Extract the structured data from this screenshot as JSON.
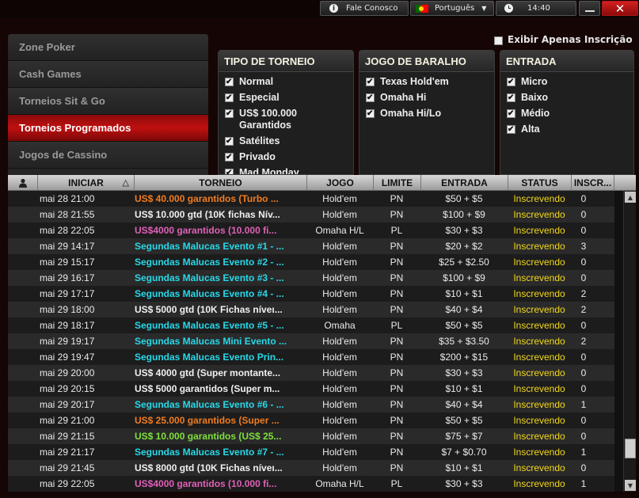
{
  "topbar": {
    "contact_label": "Fale Conosco",
    "language_label": "Português",
    "clock_label": "14:40",
    "close_label": "✕"
  },
  "menu": [
    {
      "label": "Zone Poker",
      "active": false
    },
    {
      "label": "Cash Games",
      "active": false
    },
    {
      "label": "Torneios Sit & Go",
      "active": false
    },
    {
      "label": "Torneios Programados",
      "active": true
    },
    {
      "label": "Jogos de Cassino",
      "active": false
    }
  ],
  "filters": {
    "exibir_label": "Exibir Apenas Inscrição",
    "tipo": {
      "title": "TIPO DE TORNEIO",
      "options": [
        "Normal",
        "Especial",
        "US$ 100.000 Garantidos",
        "Satélites",
        "Privado",
        "Mad Monday"
      ]
    },
    "jogo": {
      "title": "JOGO DE BARALHO",
      "options": [
        "Texas Hold'em",
        "Omaha Hi",
        "Omaha Hi/Lo"
      ]
    },
    "entrada": {
      "title": "ENTRADA",
      "options": [
        "Micro",
        "Baixo",
        "Médio",
        "Alta"
      ]
    }
  },
  "table": {
    "headers": [
      "INICIAR",
      "TORNEIO",
      "JOGO",
      "LIMITE",
      "ENTRADA",
      "STATUS",
      "INSCR..."
    ],
    "sort_indicator": "△",
    "rows": [
      {
        "date": "mai 28 21:00",
        "name": "US$ 40.000 garantidos (Turbo ...",
        "color": "#f07c20",
        "game": "Hold'em",
        "limit": "PN",
        "buyin": "$50 + $5",
        "status": "Inscrevendo",
        "reg": "0"
      },
      {
        "date": "mai 28 21:55",
        "name": "US$ 10.000 gtd (10K fichas Nív...",
        "color": "#f0f0f0",
        "game": "Hold'em",
        "limit": "PN",
        "buyin": "$100 + $9",
        "status": "Inscrevendo",
        "reg": "0"
      },
      {
        "date": "mai 28 22:05",
        "name": "US$4000 garantidos (10.000 fi...",
        "color": "#e060b8",
        "game": "Omaha H/L",
        "limit": "PL",
        "buyin": "$30 + $3",
        "status": "Inscrevendo",
        "reg": "0"
      },
      {
        "date": "mai 29 14:17",
        "name": "Segundas Malucas Evento #1 - ...",
        "color": "#28d8e8",
        "game": "Hold'em",
        "limit": "PN",
        "buyin": "$20 + $2",
        "status": "Inscrevendo",
        "reg": "3"
      },
      {
        "date": "mai 29 15:17",
        "name": "Segundas Malucas Evento #2 - ...",
        "color": "#28d8e8",
        "game": "Hold'em",
        "limit": "PN",
        "buyin": "$25 + $2.50",
        "status": "Inscrevendo",
        "reg": "0"
      },
      {
        "date": "mai 29 16:17",
        "name": "Segundas Malucas Evento #3 - ...",
        "color": "#28d8e8",
        "game": "Hold'em",
        "limit": "PN",
        "buyin": "$100 + $9",
        "status": "Inscrevendo",
        "reg": "0"
      },
      {
        "date": "mai 29 17:17",
        "name": "Segundas Malucas Evento #4 - ...",
        "color": "#28d8e8",
        "game": "Hold'em",
        "limit": "PN",
        "buyin": "$10 + $1",
        "status": "Inscrevendo",
        "reg": "2"
      },
      {
        "date": "mai 29 18:00",
        "name": "US$ 5000 gtd (10K Fichas níveı...",
        "color": "#f0f0f0",
        "game": "Hold'em",
        "limit": "PN",
        "buyin": "$40 + $4",
        "status": "Inscrevendo",
        "reg": "2"
      },
      {
        "date": "mai 29 18:17",
        "name": "Segundas Malucas Evento #5 - ...",
        "color": "#28d8e8",
        "game": "Omaha",
        "limit": "PL",
        "buyin": "$50 + $5",
        "status": "Inscrevendo",
        "reg": "0"
      },
      {
        "date": "mai 29 19:17",
        "name": "Segundas Malucas Mini Evento ...",
        "color": "#28d8e8",
        "game": "Hold'em",
        "limit": "PN",
        "buyin": "$35 + $3.50",
        "status": "Inscrevendo",
        "reg": "2"
      },
      {
        "date": "mai 29 19:47",
        "name": "Segundas Malucas Evento Prin...",
        "color": "#28d8e8",
        "game": "Hold'em",
        "limit": "PN",
        "buyin": "$200 + $15",
        "status": "Inscrevendo",
        "reg": "0"
      },
      {
        "date": "mai 29 20:00",
        "name": "US$ 4000 gtd (Super montante...",
        "color": "#f0f0f0",
        "game": "Hold'em",
        "limit": "PN",
        "buyin": "$30 + $3",
        "status": "Inscrevendo",
        "reg": "0"
      },
      {
        "date": "mai 29 20:15",
        "name": "US$ 5000 garantidos (Super m...",
        "color": "#f0f0f0",
        "game": "Hold'em",
        "limit": "PN",
        "buyin": "$10 + $1",
        "status": "Inscrevendo",
        "reg": "0"
      },
      {
        "date": "mai 29 20:17",
        "name": "Segundas Malucas Evento #6 - ...",
        "color": "#28d8e8",
        "game": "Hold'em",
        "limit": "PN",
        "buyin": "$40 + $4",
        "status": "Inscrevendo",
        "reg": "1"
      },
      {
        "date": "mai 29 21:00",
        "name": "US$ 25.000 garantidos (Super ...",
        "color": "#f07c20",
        "game": "Hold'em",
        "limit": "PN",
        "buyin": "$50 + $5",
        "status": "Inscrevendo",
        "reg": "0"
      },
      {
        "date": "mai 29 21:15",
        "name": "US$ 10.000 garantidos (US$ 25...",
        "color": "#7ee03a",
        "game": "Hold'em",
        "limit": "PN",
        "buyin": "$75 + $7",
        "status": "Inscrevendo",
        "reg": "0"
      },
      {
        "date": "mai 29 21:17",
        "name": "Segundas Malucas Evento #7 - ...",
        "color": "#28d8e8",
        "game": "Hold'em",
        "limit": "PN",
        "buyin": "$7 + $0.70",
        "status": "Inscrevendo",
        "reg": "1"
      },
      {
        "date": "mai 29 21:45",
        "name": "US$ 8000 gtd (10K Fichas níveı...",
        "color": "#f0f0f0",
        "game": "Hold'em",
        "limit": "PN",
        "buyin": "$10 + $1",
        "status": "Inscrevendo",
        "reg": "0"
      },
      {
        "date": "mai 29 22:05",
        "name": "US$4000 garantidos (10.000 fi...",
        "color": "#e060b8",
        "game": "Omaha H/L",
        "limit": "PL",
        "buyin": "$30 + $3",
        "status": "Inscrevendo",
        "reg": "1"
      }
    ]
  }
}
